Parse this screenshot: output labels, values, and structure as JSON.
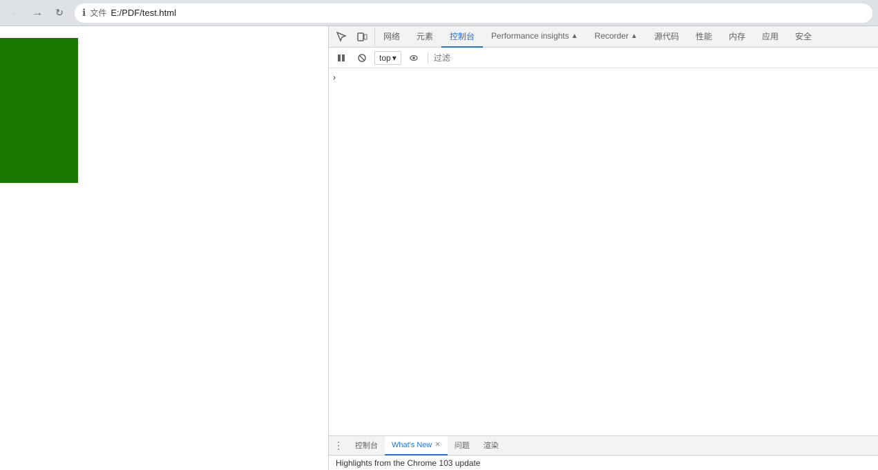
{
  "browser": {
    "back_label": "←",
    "forward_label": "→",
    "reload_label": "↻",
    "file_indicator": "文件",
    "address": "E:/PDF/test.html",
    "info_icon": "ℹ"
  },
  "devtools": {
    "tabs": [
      {
        "label": "网络",
        "active": false
      },
      {
        "label": "元素",
        "active": false
      },
      {
        "label": "控制台",
        "active": true
      },
      {
        "label": "Performance insights",
        "active": false,
        "badge": "▲"
      },
      {
        "label": "Recorder",
        "active": false,
        "badge": "▲"
      },
      {
        "label": "源代码",
        "active": false
      },
      {
        "label": "性能",
        "active": false
      },
      {
        "label": "内存",
        "active": false
      },
      {
        "label": "应用",
        "active": false
      },
      {
        "label": "安全",
        "active": false
      }
    ],
    "console_toolbar": {
      "play_icon": "▶",
      "block_icon": "⊘",
      "top_label": "top",
      "dropdown_icon": "▾",
      "eye_icon": "👁",
      "filter_placeholder": "过滤"
    },
    "console_content": {
      "arrow": "›"
    }
  },
  "bottom_panel": {
    "tabs": [
      {
        "label": "控制台",
        "active": false,
        "closeable": false
      },
      {
        "label": "What's New",
        "active": true,
        "closeable": true
      },
      {
        "label": "问题",
        "active": false,
        "closeable": false
      },
      {
        "label": "渲染",
        "active": false,
        "closeable": false
      }
    ],
    "content": "Highlights from the Chrome 103 update"
  }
}
